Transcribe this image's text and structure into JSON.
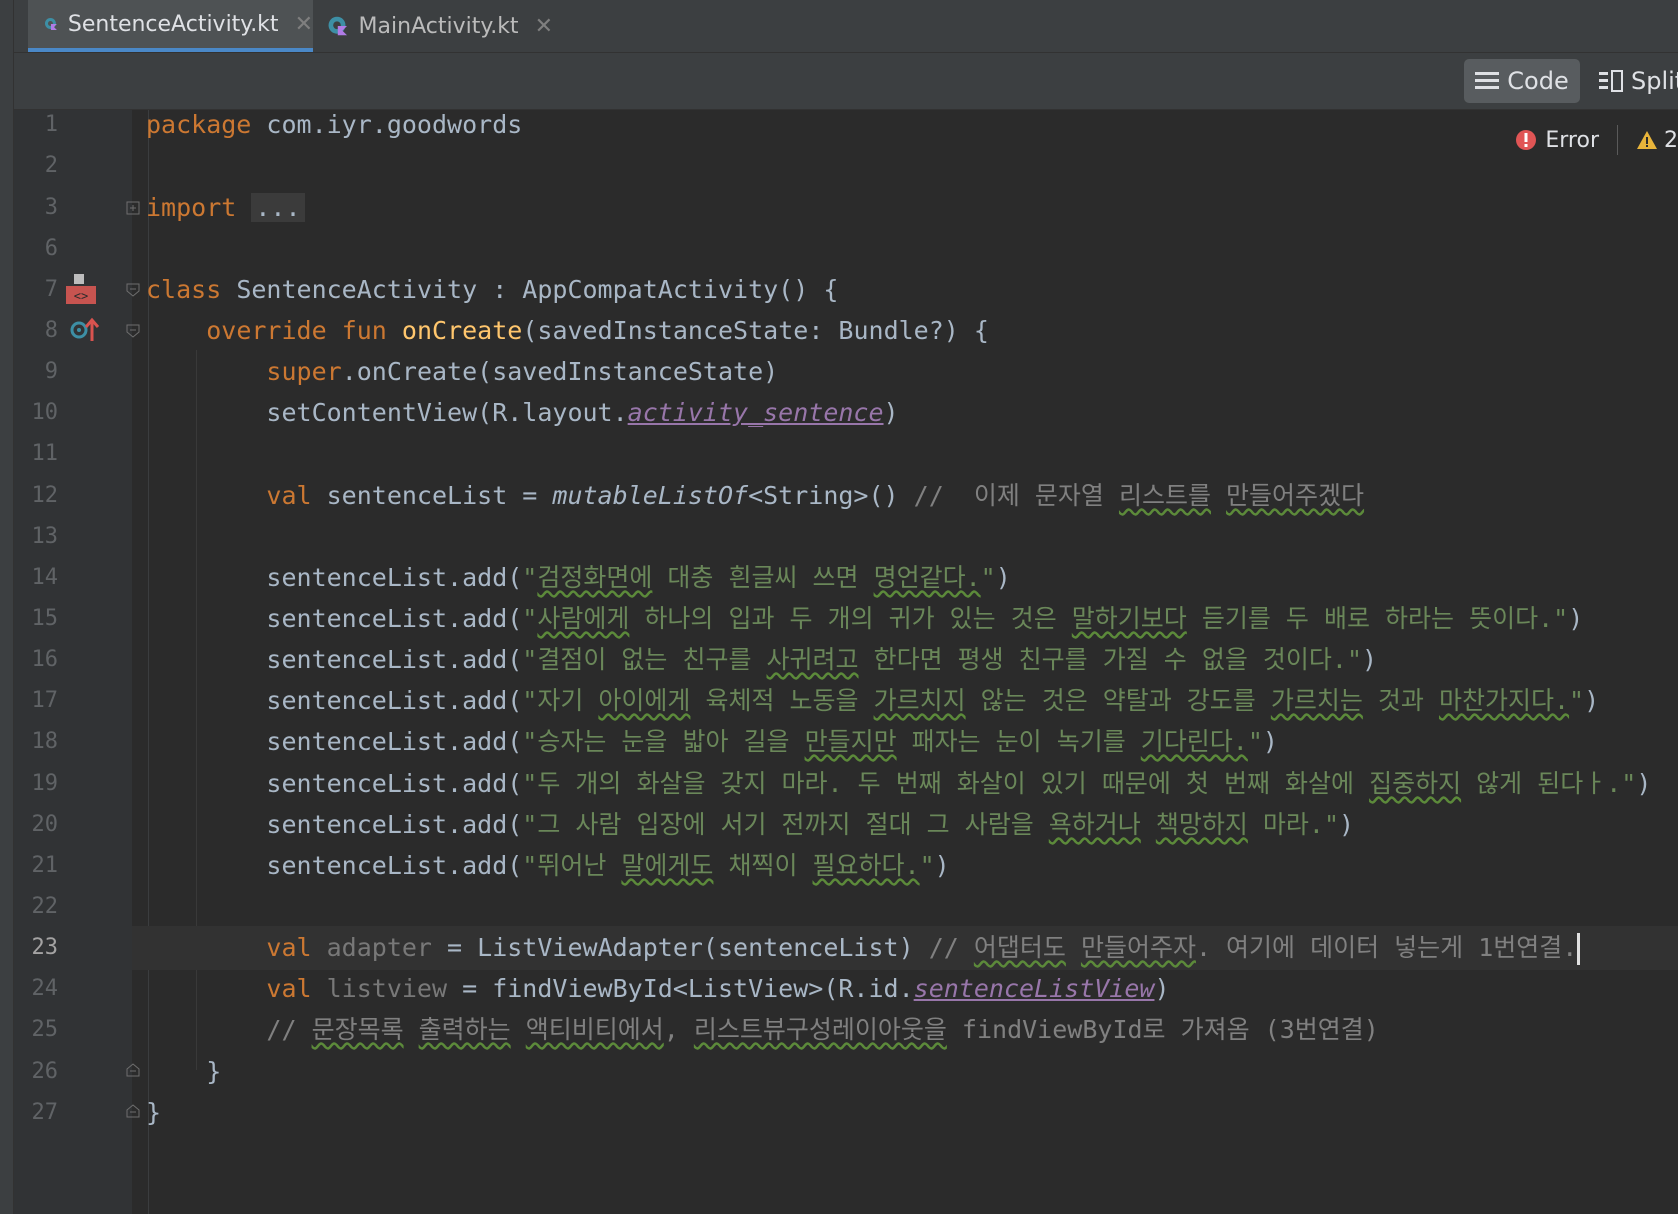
{
  "tabs": [
    {
      "label": "SentenceActivity.kt",
      "active": true
    },
    {
      "label": "MainActivity.kt",
      "active": false
    }
  ],
  "toolbar": {
    "code_label": "Code",
    "split_label": "Split"
  },
  "inspections": {
    "error_label": "Error",
    "warning_count": "2"
  },
  "line_numbers": [
    "1",
    "2",
    "3",
    "6",
    "7",
    "8",
    "9",
    "10",
    "11",
    "12",
    "13",
    "14",
    "15",
    "16",
    "17",
    "18",
    "19",
    "20",
    "21",
    "22",
    "23",
    "24",
    "25",
    "26",
    "27"
  ],
  "code": {
    "l1_kw": "package",
    "l1_rest": "com.iyr.goodwords",
    "l3_kw": "import",
    "l3_folded": "...",
    "l7_kw": "class",
    "l7_rest": "SentenceActivity : AppCompatActivity() {",
    "l8_kw1": "override",
    "l8_kw2": "fun",
    "l8_fn": "onCreate",
    "l8_rest": "(savedInstanceState: Bundle?) {",
    "l9_kw": "super",
    "l9_rest": ".onCreate(savedInstanceState)",
    "l10_a": "setContentView(R.layout.",
    "l10_res": "activity_sentence",
    "l10_b": ")",
    "l12_kw": "val",
    "l12_a": " sentenceList = ",
    "l12_fn": "mutableListOf",
    "l12_b": "<String>() ",
    "l12_cmt_a": "//  이제 문자열 ",
    "l12_cmt_typo1": "리스트를",
    "l12_cmt_b": " ",
    "l12_cmt_typo2": "만들어주겠다",
    "add_prefix": "sentenceList.add(",
    "add_suffix": ")",
    "l14_a": "\"",
    "l14_t1": "검정화면에",
    "l14_b": " 대충 흰글씨 쓰면 ",
    "l14_t2": "명언같다.",
    "l14_c": "\"",
    "l15_a": "\"",
    "l15_t1": "사람에게",
    "l15_b": " 하나의 입과 두 개의 귀가 있는 것은 ",
    "l15_t2": "말하기보다",
    "l15_c": " 듣기를 두 배로 하라는 뜻이다.\"",
    "l16_a": "\"결점이 없는 친구를 ",
    "l16_t1": "사귀려고",
    "l16_b": " 한다면 평생 친구를 가질 수 없을 것이다.\"",
    "l17_a": "\"자기 ",
    "l17_t1": "아이에게",
    "l17_b": " 육체적 노동을 ",
    "l17_t2": "가르치지",
    "l17_c": " 않는 것은 약탈과 강도를 ",
    "l17_t3": "가르치는",
    "l17_d": " 것과 ",
    "l17_t4": "마찬가지다.",
    "l17_e": "\"",
    "l18_a": "\"승자는 눈을 밟아 길을 ",
    "l18_t1": "만들지만",
    "l18_b": " 패자는 눈이 녹기를 ",
    "l18_t2": "기다린다.",
    "l18_c": "\"",
    "l19_a": "\"두 개의 화살을 갖지 마라. 두 번째 화살이 있기 때문에 첫 번째 화살에 ",
    "l19_t1": "집중하지",
    "l19_b": " 않게 된다ㅏ.\"",
    "l20_a": "\"그 사람 입장에 서기 전까지 절대 그 사람을 ",
    "l20_t1": "욕하거나",
    "l20_b": " ",
    "l20_t2": "책망하지",
    "l20_c": " 마라.\"",
    "l21_a": "\"뛰어난 ",
    "l21_t1": "말에게도",
    "l21_b": " 채찍이 ",
    "l21_t2": "필요하다.",
    "l21_c": "\"",
    "l23_kw": "val",
    "l23_var": " adapter",
    "l23_a": " = ListViewAdapter(sentenceList) ",
    "l23_cmt_a": "// ",
    "l23_cmt_t1": "어댑터도",
    "l23_cmt_b": " ",
    "l23_cmt_t2": "만들어주자",
    "l23_cmt_c": ". 여기에 데이터 넣는게 1번연결.",
    "l24_kw": "val",
    "l24_var": " listview",
    "l24_a": " = findViewById<ListView>(R.id.",
    "l24_res": "sentenceListView",
    "l24_b": ")",
    "l25_cmt_a": "// ",
    "l25_t1": "문장목록",
    "l25_b": " ",
    "l25_t2": "출력하는",
    "l25_c": " ",
    "l25_t3": "액티비티에서",
    "l25_d": ", ",
    "l25_t4": "리스트뷰구성레이아웃을",
    "l25_e": " findViewById로 가져옴 (3번연결)",
    "l26": "}",
    "l27": "}"
  },
  "colors": {
    "background": "#2b2b2b",
    "keyword": "#cc7832",
    "string": "#6a8759",
    "function": "#ffc66d",
    "comment": "#808080",
    "resource": "#9876aa",
    "error": "#e05555",
    "warning": "#e8b43a",
    "tab_underline": "#4a88c7"
  },
  "icons": [
    "kotlin-file-icon",
    "close-icon",
    "list-icon",
    "split-icon",
    "error-icon",
    "warning-icon",
    "fold-icon",
    "layout-preview-icon",
    "override-icon"
  ]
}
